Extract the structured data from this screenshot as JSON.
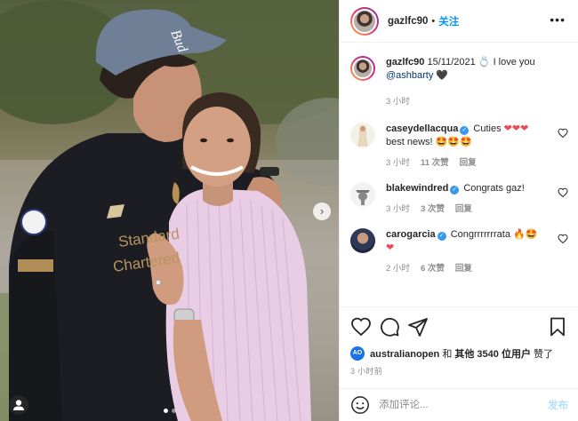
{
  "post": {
    "author": "gazlfc90",
    "follow_label": "关注",
    "separator": "•",
    "more_label": "•••"
  },
  "caption": {
    "username": "gazlfc90",
    "date": "15/11/2021",
    "text": "I love you",
    "mention": "@ashbarty",
    "emoji": "🖤",
    "ring_emoji": "💍",
    "time": "3 小时"
  },
  "photo": {
    "cap_text": "Bud",
    "shirt_text_1": "Standard",
    "shirt_text_2": "Chartered",
    "next_label": "›"
  },
  "comments": [
    {
      "username": "caseydellacqua",
      "text_a": "Cuties",
      "text_hearts": "❤❤❤",
      "text_b": "best news!",
      "text_emoji": "🤩🤩🤩",
      "time": "3 小时",
      "likes": "11 次赞",
      "reply": "回复"
    },
    {
      "username": "blakewindred",
      "text": "Congrats gaz!",
      "time": "3 小时",
      "likes": "3 次赞",
      "reply": "回复"
    },
    {
      "username": "carogarcia",
      "text": "Congrrrrrrrata",
      "text_emoji": "🔥🤩",
      "text_heart": "❤",
      "time": "2 小时",
      "likes": "6 次赞",
      "reply": "回复"
    }
  ],
  "likes": {
    "badge": "AO",
    "user": "australianopen",
    "conj": "和",
    "others": "其他 3540 位用户",
    "suffix": "赞了"
  },
  "time_ago": "3 小时前",
  "comment_box": {
    "placeholder": "添加评论...",
    "post_label": "发布"
  }
}
